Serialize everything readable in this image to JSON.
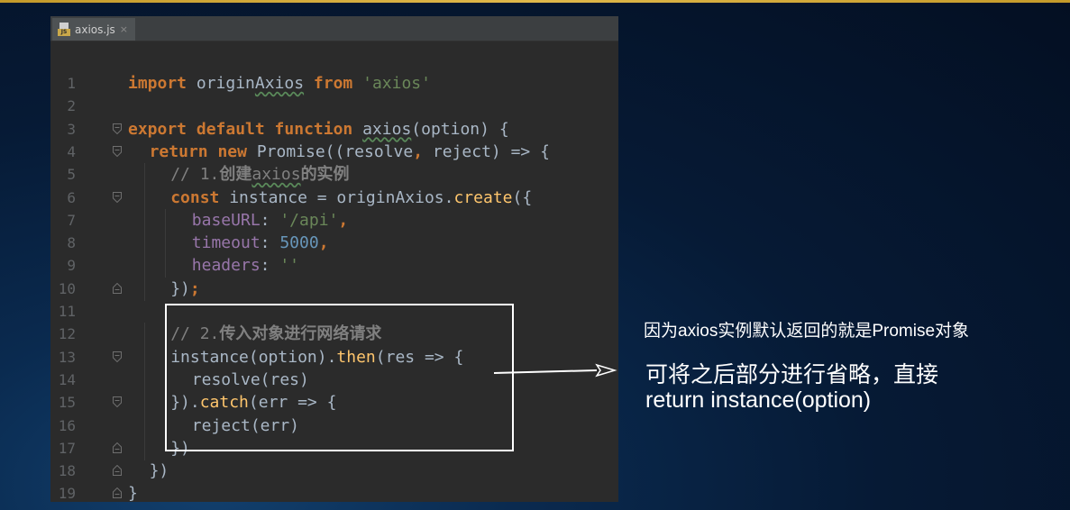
{
  "editor": {
    "tab": {
      "filename": "axios.js",
      "icon": "js-file-icon",
      "close": "×"
    }
  },
  "code_lines": [
    {
      "n": "1",
      "indent": 0,
      "tokens": [
        [
          "kw",
          "import "
        ],
        [
          "",
          "origin"
        ],
        [
          "wavy",
          "Axios"
        ],
        [
          "",
          ""
        ],
        [
          "kw",
          " from "
        ],
        [
          "str",
          "'axios'"
        ]
      ]
    },
    {
      "n": "2",
      "indent": 0,
      "tokens": []
    },
    {
      "n": "3",
      "indent": 0,
      "tokens": [
        [
          "kw",
          "export default function "
        ],
        [
          "wavy",
          "axios"
        ],
        [
          "",
          "(option) {"
        ]
      ]
    },
    {
      "n": "4",
      "indent": 1,
      "tokens": [
        [
          "kw",
          "return new "
        ],
        [
          "",
          "Promise((resolve"
        ],
        [
          "kw",
          ","
        ],
        [
          "",
          " reject) => {"
        ]
      ]
    },
    {
      "n": "5",
      "indent": 2,
      "tokens": [
        [
          "cm",
          "// 1."
        ],
        [
          "cmb",
          "创建"
        ],
        [
          "cm wavy",
          "axios"
        ],
        [
          "cmb",
          "的实例"
        ]
      ]
    },
    {
      "n": "6",
      "indent": 2,
      "tokens": [
        [
          "kw",
          "const "
        ],
        [
          "",
          "instance = originAxios."
        ],
        [
          "fn",
          "create"
        ],
        [
          "",
          "({"
        ]
      ]
    },
    {
      "n": "7",
      "indent": 3,
      "tokens": [
        [
          "prop",
          "baseURL"
        ],
        [
          "",
          ": "
        ],
        [
          "str",
          "'/api'"
        ],
        [
          "kw",
          ","
        ]
      ]
    },
    {
      "n": "8",
      "indent": 3,
      "tokens": [
        [
          "prop",
          "timeout"
        ],
        [
          "",
          ": "
        ],
        [
          "num",
          "5000"
        ],
        [
          "kw",
          ","
        ]
      ]
    },
    {
      "n": "9",
      "indent": 3,
      "tokens": [
        [
          "prop",
          "headers"
        ],
        [
          "",
          ": "
        ],
        [
          "str",
          "''"
        ]
      ]
    },
    {
      "n": "10",
      "indent": 2,
      "tokens": [
        [
          "",
          "})"
        ],
        [
          "kw",
          ";"
        ]
      ]
    },
    {
      "n": "11",
      "indent": 0,
      "tokens": []
    },
    {
      "n": "12",
      "indent": 2,
      "tokens": [
        [
          "cm",
          "// 2."
        ],
        [
          "cmb",
          "传入对象进行网络请求"
        ]
      ]
    },
    {
      "n": "13",
      "indent": 2,
      "tokens": [
        [
          "",
          "instance(option)."
        ],
        [
          "fn",
          "then"
        ],
        [
          "",
          "(res => {"
        ]
      ]
    },
    {
      "n": "14",
      "indent": 3,
      "tokens": [
        [
          "",
          "resolve(res)"
        ]
      ]
    },
    {
      "n": "15",
      "indent": 2,
      "tokens": [
        [
          "",
          "})."
        ],
        [
          "fn",
          "catch"
        ],
        [
          "",
          "(err => {"
        ]
      ]
    },
    {
      "n": "16",
      "indent": 3,
      "tokens": [
        [
          "",
          "reject(err)"
        ]
      ]
    },
    {
      "n": "17",
      "indent": 2,
      "tokens": [
        [
          "",
          "})"
        ]
      ]
    },
    {
      "n": "18",
      "indent": 1,
      "tokens": [
        [
          "",
          "})"
        ]
      ]
    },
    {
      "n": "19",
      "indent": 0,
      "tokens": [
        [
          "",
          "}"
        ]
      ]
    }
  ],
  "folds": {
    "open": [
      "3",
      "4",
      "6",
      "13",
      "15"
    ],
    "close": [
      "10",
      "17",
      "18",
      "19"
    ]
  },
  "annotation": {
    "note1": "因为axios实例默认返回的就是Promise对象",
    "note2": "可将之后部分进行省略，直接",
    "note3": "return instance(option)"
  }
}
